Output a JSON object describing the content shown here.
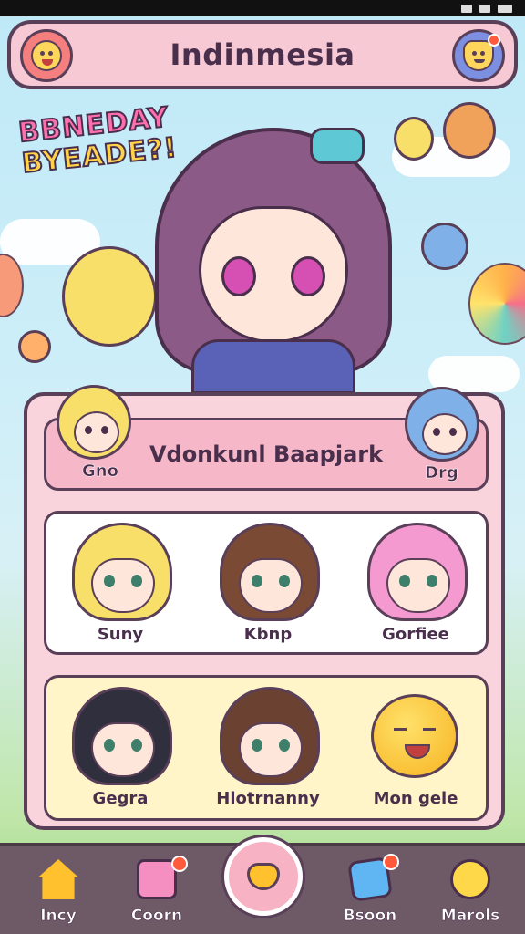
{
  "app": {
    "title": "Indinmesia"
  },
  "banner": {
    "line1": "BBNEDAY",
    "line2": "BYEADE?!"
  },
  "featured": {
    "title": "Vdonkunl Baapjark",
    "left_label": "Gno",
    "right_label": "Drg"
  },
  "characters_row1": [
    {
      "name": "Suny",
      "hair_color": "#f7df6a"
    },
    {
      "name": "Kbnp",
      "hair_color": "#7a4a35"
    },
    {
      "name": "Gorfiee",
      "hair_color": "#f59ad0"
    }
  ],
  "characters_row2": [
    {
      "name": "Gegra",
      "hair_color": "#2f2f3d"
    },
    {
      "name": "Hlotrnanny",
      "hair_color": "#6b4131"
    },
    {
      "name": "Mon gele",
      "icon": "pumpkin-icon"
    }
  ],
  "navbar": {
    "items": [
      {
        "label": "Incy",
        "icon": "house-icon"
      },
      {
        "label": "Coorn",
        "icon": "cat-icon"
      },
      {
        "label": "Bsoon",
        "icon": "gem-icon"
      },
      {
        "label": "Marols",
        "icon": "puff-icon"
      }
    ]
  },
  "colors": {
    "accent_pink": "#f7c9d4",
    "outline": "#5a3f59",
    "nav_bg": "#6e5a66"
  }
}
